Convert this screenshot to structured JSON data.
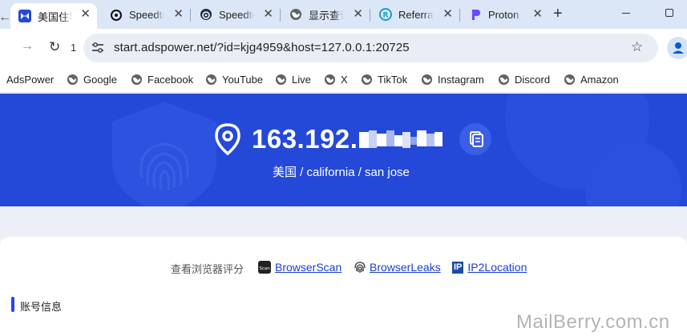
{
  "tabs": [
    {
      "title": "美国住宅",
      "close": "✕",
      "active": true
    },
    {
      "title": "Speedtest",
      "close": "✕",
      "active": false
    },
    {
      "title": "Speedtest",
      "close": "✕",
      "active": false
    },
    {
      "title": "显示查询",
      "close": "✕",
      "active": false
    },
    {
      "title": "Referral",
      "close": "✕",
      "active": false
    },
    {
      "title": "Proton",
      "close": "✕",
      "active": false
    }
  ],
  "new_tab_label": "+",
  "toolbar": {
    "back": "←",
    "forward": "→",
    "reload": "↻",
    "reload_count": "1",
    "url": "start.adspower.net/?id=kjg4959&host=127.0.0.1:20725",
    "star": "☆"
  },
  "bookmarks": [
    "AdsPower",
    "Google",
    "Facebook",
    "YouTube",
    "Live",
    "X",
    "TikTok",
    "Instagram",
    "Discord",
    "Amazon"
  ],
  "hero": {
    "ip_visible": "163.192.",
    "location": "美国 / california / san jose"
  },
  "scores": {
    "label": "查看浏览器评分",
    "links": [
      {
        "text": "BrowserScan",
        "icon": "browserscan-logo"
      },
      {
        "text": "BrowserLeaks",
        "icon": "browserleaks-logo"
      },
      {
        "text": "IP2Location",
        "icon": "ip2location-logo"
      }
    ],
    "ip_logo_text": "IP"
  },
  "account": {
    "title": "账号信息"
  },
  "watermark": "MailBerry.com.cn",
  "colors": {
    "hero": "#2449d8",
    "link": "#1a3fd1",
    "tabstrip": "#dbe6f6"
  }
}
